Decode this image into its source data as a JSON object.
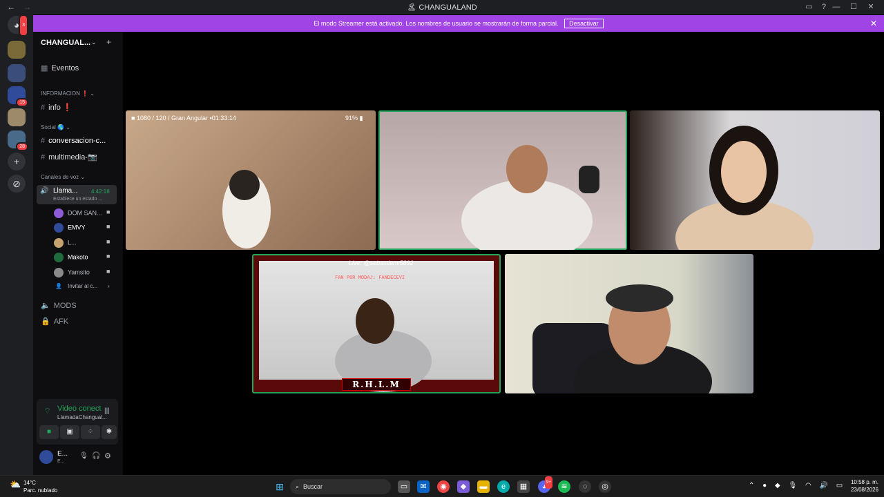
{
  "window": {
    "title": "CHANGUALAND",
    "back": "←",
    "forward": "→",
    "minimize": "—",
    "maximize": "☐",
    "close": "✕"
  },
  "banner": {
    "text": "El modo Streamer está activado. Los nombres de usuario se mostrarán de forma parcial.",
    "button": "Desactivar",
    "close": "✕"
  },
  "guilds": {
    "home_badge": "3",
    "badge_a": "15",
    "badge_b": "28",
    "add": "+",
    "explore": "⊘"
  },
  "server": {
    "name": "CHANGUAL...",
    "chev": "⌄",
    "add_member": "+"
  },
  "sidebar": {
    "events": "Eventos",
    "cat_info": "INFORMACION ❗ ⌄",
    "info_channel": "info ❗",
    "cat_social": "Social 🌎 ⌄",
    "ch_conversacion": "conversacion-c...",
    "ch_multimedia": "multimedia-📷",
    "cat_voice": "Canales de voz ⌄",
    "voice_channel": "Llama...",
    "voice_time": "4:42:18",
    "voice_status": "Establece un estado ...",
    "users": [
      {
        "name": "DOM SAN...",
        "color": "#8e5bd6"
      },
      {
        "name": "EMVY",
        "color": "#2f4b9a"
      },
      {
        "name": "L...",
        "color": "#c6a26e"
      },
      {
        "name": "Makoto",
        "color": "#1f6b3e"
      },
      {
        "name": "Yamsito",
        "color": "#8a8a8a"
      }
    ],
    "invite": "Invitar al c...",
    "mods": "MODS",
    "afk": "AFK"
  },
  "voice_panel": {
    "status": "Video conectado",
    "channel": "LlamadaChangual...",
    "hangup": "☎"
  },
  "user_panel": {
    "name": "E...",
    "sub": "E..."
  },
  "tiles": {
    "t1": {
      "resolution": "1080",
      "fps": "120",
      "lens": "Gran Angular",
      "rec": "01:33:14",
      "battery": "91%"
    },
    "t4": {
      "live": "Live: @sebastianv5892",
      "fanline": "FAN POR MODA♪: FANDECEVI",
      "logo": "R.H.L.M"
    }
  },
  "taskbar": {
    "temp": "14°C",
    "weather": "Parc. nublado",
    "search": "Buscar",
    "time": "10:58 p. m.",
    "date": "23/08/2026",
    "discord_badge": "9+"
  },
  "colors": {
    "accent": "#a144e6",
    "speaking": "#23a55a",
    "danger": "#f23f43"
  }
}
